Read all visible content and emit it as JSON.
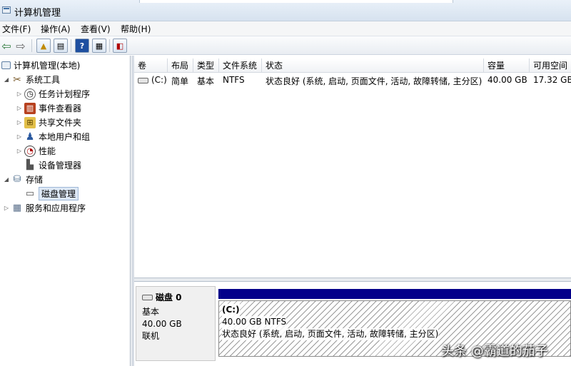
{
  "window": {
    "title": "计算机管理"
  },
  "menu": [
    "文件(F)",
    "操作(A)",
    "查看(V)",
    "帮助(H)"
  ],
  "tree": {
    "root": "计算机管理(本地)",
    "system_tools": "系统工具",
    "task_scheduler": "任务计划程序",
    "event_viewer": "事件查看器",
    "shared_folders": "共享文件夹",
    "local_users": "本地用户和组",
    "performance": "性能",
    "device_manager": "设备管理器",
    "storage": "存储",
    "disk_management": "磁盘管理",
    "services_apps": "服务和应用程序"
  },
  "table": {
    "headers": [
      "卷",
      "布局",
      "类型",
      "文件系统",
      "状态",
      "容量",
      "可用空间"
    ],
    "rows": [
      {
        "volume": "(C:)",
        "layout": "简单",
        "type": "基本",
        "fs": "NTFS",
        "status": "状态良好 (系统, 启动, 页面文件, 活动, 故障转储, 主分区)",
        "capacity": "40.00 GB",
        "free": "17.32 GB"
      }
    ]
  },
  "disk": {
    "name": "磁盘 0",
    "type": "基本",
    "size": "40.00 GB",
    "state": "联机",
    "partition": {
      "name": "(C:)",
      "size_fs": "40.00 GB NTFS",
      "status": "状态良好 (系统, 启动, 页面文件, 活动, 故障转储, 主分区)"
    }
  },
  "watermark": "头条 @霸道的茄子",
  "colors": {
    "partition_bar": "#03008a",
    "selection": "#dde8f5"
  }
}
